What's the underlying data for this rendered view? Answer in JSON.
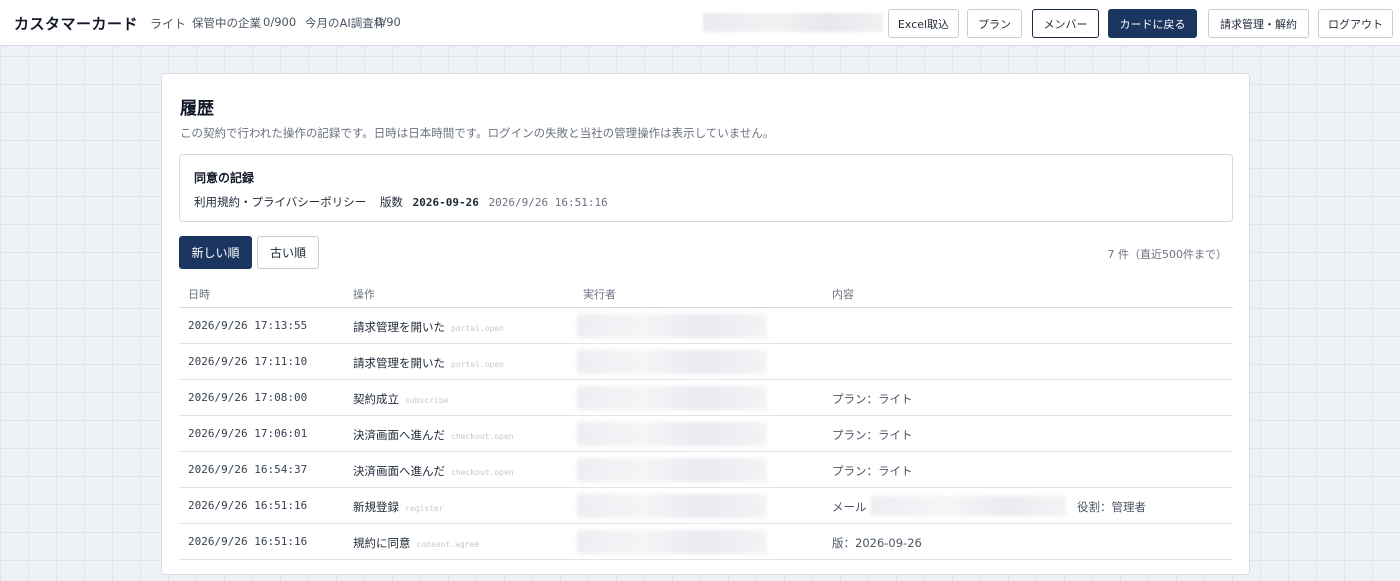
{
  "header": {
    "brand": "カスタマーカード",
    "plan": "ライト",
    "stored_label": "保管中の企業",
    "stored_value": "0/900",
    "ai_label": "今月のAI調査枠",
    "ai_value": "0/90",
    "buttons": {
      "excel": "Excel取込",
      "plan": "プラン",
      "members": "メンバー",
      "back": "カードに戻る",
      "billing": "請求管理・解約",
      "logout": "ログアウト"
    }
  },
  "history": {
    "title": "履歴",
    "description": "この契約で行われた操作の記録です。日時は日本時間です。ログインの失敗と当社の管理操作は表示していません。",
    "consent": {
      "title": "同意の記録",
      "doc": "利用規約・プライバシーポリシー",
      "version_label": "版数",
      "version": "2026-09-26",
      "timestamp": "2026/9/26 16:51:16"
    },
    "sort_newest": "新しい順",
    "sort_oldest": "古い順",
    "count": "7 件（直近500件まで）",
    "columns": {
      "time": "日時",
      "operation": "操作",
      "actor": "実行者",
      "content": "内容"
    },
    "rows": [
      {
        "time": "2026/9/26 17:13:55",
        "op": "請求管理を開いた",
        "code": "portal.open",
        "content": ""
      },
      {
        "time": "2026/9/26 17:11:10",
        "op": "請求管理を開いた",
        "code": "portal.open",
        "content": ""
      },
      {
        "time": "2026/9/26 17:08:00",
        "op": "契約成立",
        "code": "subscribe",
        "content": "プラン：ライト"
      },
      {
        "time": "2026/9/26 17:06:01",
        "op": "決済画面へ進んだ",
        "code": "checkout.open",
        "content": "プラン：ライト"
      },
      {
        "time": "2026/9/26 16:54:37",
        "op": "決済画面へ進んだ",
        "code": "checkout.open",
        "content": "プラン：ライト"
      },
      {
        "time": "2026/9/26 16:51:16",
        "op": "新規登録",
        "code": "register",
        "content": "メール",
        "role": "役割：管理者"
      },
      {
        "time": "2026/9/26 16:51:16",
        "op": "規約に同意",
        "code": "consent.agree",
        "content": "版：2026-09-26"
      }
    ]
  }
}
